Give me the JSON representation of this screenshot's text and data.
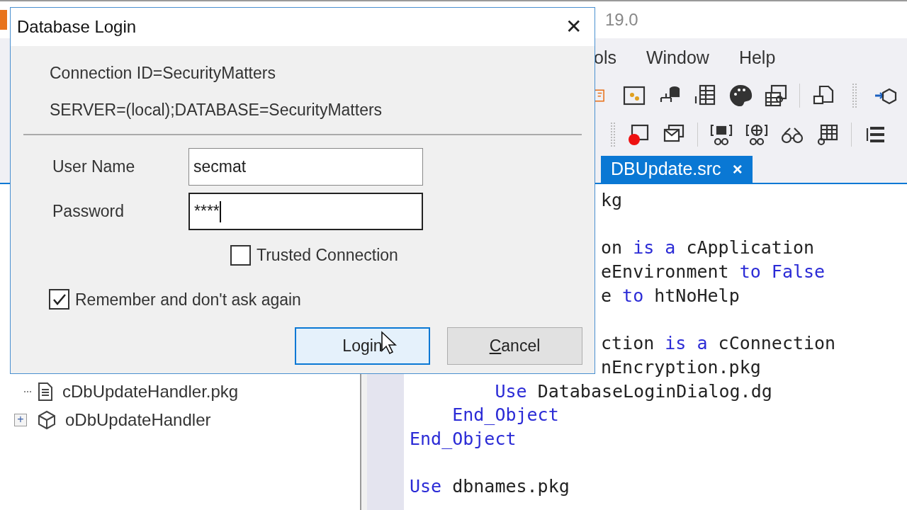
{
  "ide": {
    "title_fragment": "19.0",
    "menu": [
      "ols",
      "Window",
      "Help"
    ],
    "tab": {
      "label": "DBUpdate.src",
      "close": "×",
      "selected": true
    },
    "tree": [
      {
        "label": "cDbUpdateHandler.pkg",
        "kind": "file"
      },
      {
        "label": "oDbUpdateHandler",
        "kind": "object",
        "expander": "+"
      }
    ],
    "code": [
      {
        "kind": "code",
        "clipped": true,
        "tokens": [
          {
            "text": "kg",
            "kind": "plain"
          }
        ]
      },
      {
        "kind": "blank"
      },
      {
        "kind": "code",
        "clipped": true,
        "tokens": [
          {
            "text": "on ",
            "kind": "plain"
          },
          {
            "text": "is a",
            "kind": "keyword"
          },
          {
            "text": " cApplication",
            "kind": "plain"
          }
        ]
      },
      {
        "kind": "code",
        "clipped": true,
        "tokens": [
          {
            "text": "eEnvironment ",
            "kind": "plain"
          },
          {
            "text": "to False",
            "kind": "keyword"
          }
        ]
      },
      {
        "kind": "code",
        "clipped": true,
        "tokens": [
          {
            "text": "e ",
            "kind": "plain"
          },
          {
            "text": "to",
            "kind": "keyword"
          },
          {
            "text": " htNoHelp",
            "kind": "plain"
          }
        ]
      },
      {
        "kind": "blank"
      },
      {
        "kind": "code",
        "clipped": true,
        "tokens": [
          {
            "text": "ction ",
            "kind": "plain"
          },
          {
            "text": "is a",
            "kind": "keyword"
          },
          {
            "text": " cConnection",
            "kind": "plain"
          }
        ]
      },
      {
        "kind": "code",
        "clipped": true,
        "tokens": [
          {
            "text": "nEncryption.pkg",
            "kind": "plain"
          }
        ]
      },
      {
        "kind": "code",
        "clipped": false,
        "tokens": [
          {
            "text": "        Use",
            "kind": "keyword"
          },
          {
            "text": " DatabaseLoginDialog.dg",
            "kind": "plain"
          }
        ]
      },
      {
        "kind": "code",
        "clipped": false,
        "tokens": [
          {
            "text": "    End_Object",
            "kind": "keyword"
          }
        ]
      },
      {
        "kind": "code",
        "clipped": false,
        "tokens": [
          {
            "text": "End_Object",
            "kind": "keyword"
          }
        ]
      },
      {
        "kind": "blank"
      },
      {
        "kind": "code",
        "clipped": false,
        "tokens": [
          {
            "text": "Use",
            "kind": "keyword"
          },
          {
            "text": " dbnames.pkg",
            "kind": "plain"
          }
        ]
      }
    ]
  },
  "dialog": {
    "title": "Database Login",
    "close": "✕",
    "info": [
      "Connection ID=SecurityMatters",
      "SERVER=(local);DATABASE=SecurityMatters"
    ],
    "fields": [
      {
        "label": "User Name",
        "value": "secmat",
        "focused": false
      },
      {
        "label": "Password",
        "value": "****",
        "focused": true
      }
    ],
    "trusted": {
      "label": "Trusted Connection",
      "checked": false
    },
    "remember": {
      "label": "Remember and don't ask again",
      "checked": true
    },
    "buttons": [
      {
        "label": "Login",
        "default": true,
        "underline_first": false
      },
      {
        "label": "Cancel",
        "default": false,
        "underline_first": true
      }
    ]
  }
}
